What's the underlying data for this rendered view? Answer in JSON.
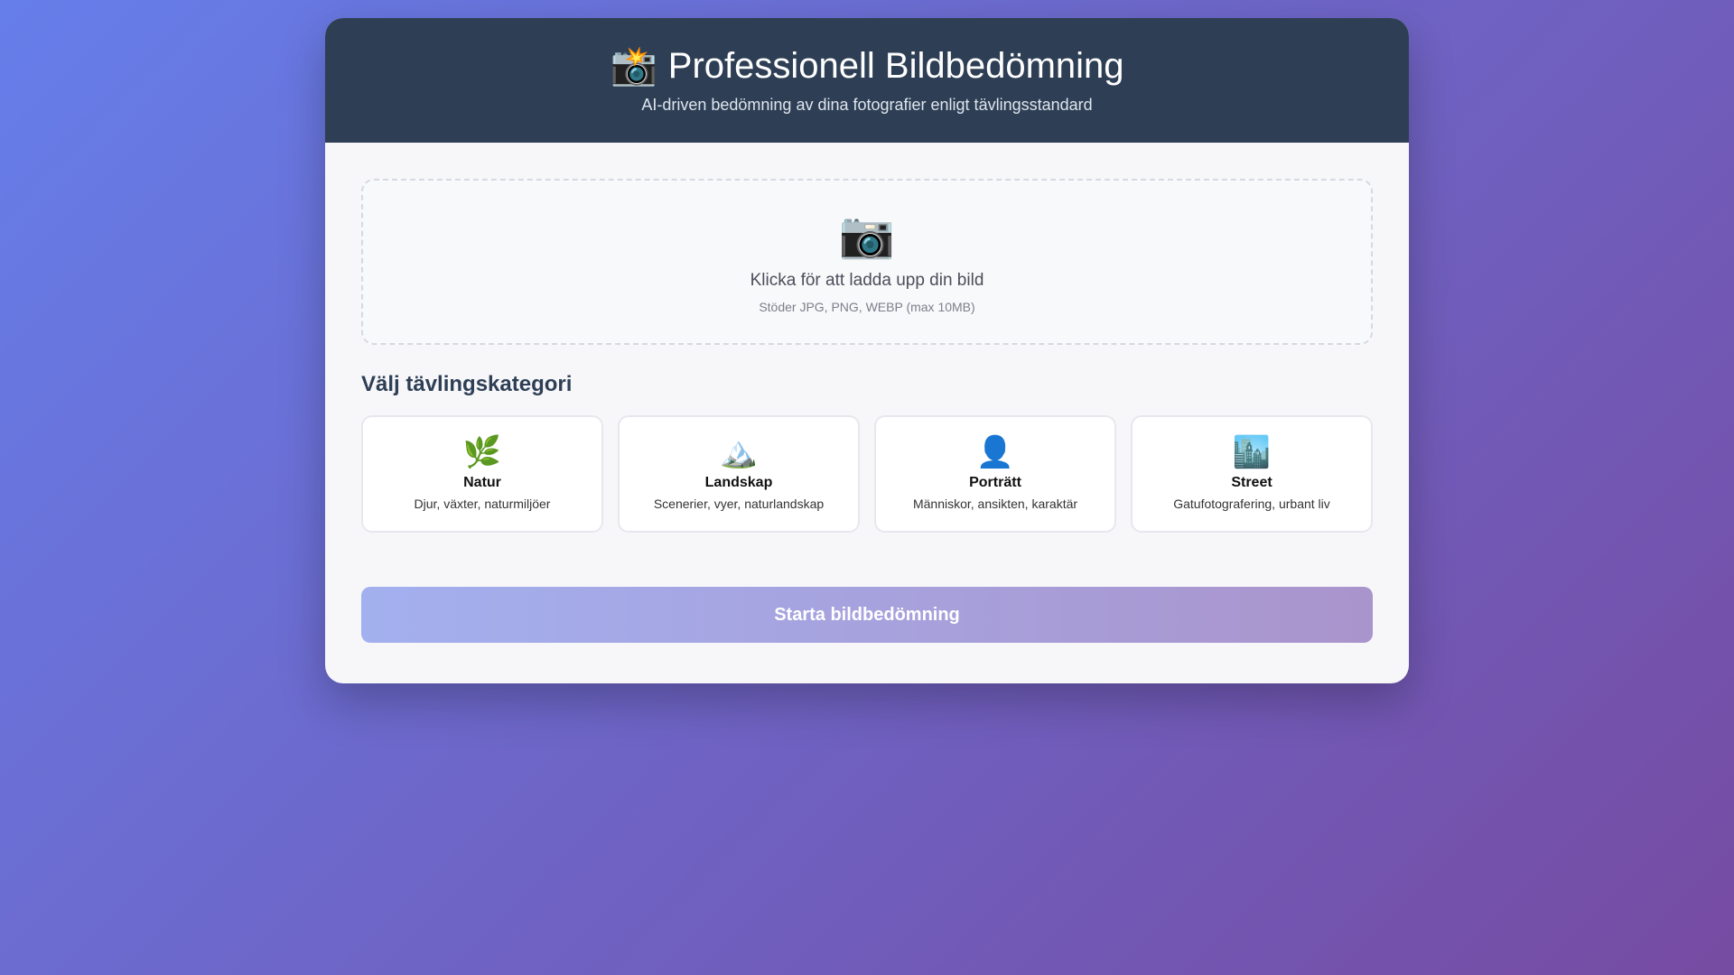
{
  "header": {
    "title_icon": "📸",
    "title": "Professionell Bildbedömning",
    "subtitle": "AI-driven bedömning av dina fotografier enligt tävlingsstandard"
  },
  "upload": {
    "icon": "📷",
    "text": "Klicka för att ladda upp din bild",
    "hint": "Stöder JPG, PNG, WEBP (max 10MB)"
  },
  "categories": {
    "title": "Välj tävlingskategori",
    "items": [
      {
        "icon": "🌿",
        "name": "Natur",
        "desc": "Djur, växter, naturmiljöer"
      },
      {
        "icon": "🏔️",
        "name": "Landskap",
        "desc": "Scenerier, vyer, naturlandskap"
      },
      {
        "icon": "👤",
        "name": "Porträtt",
        "desc": "Människor, ansikten, karaktär"
      },
      {
        "icon": "🏙️",
        "name": "Street",
        "desc": "Gatufotografering, urbant liv"
      }
    ]
  },
  "actions": {
    "start_label": "Starta bildbedömning",
    "start_disabled": true
  },
  "colors": {
    "background_start": "#667eea",
    "background_end": "#764ba2",
    "header_bg": "#2e3f55",
    "accent": "#a3b0ef"
  }
}
